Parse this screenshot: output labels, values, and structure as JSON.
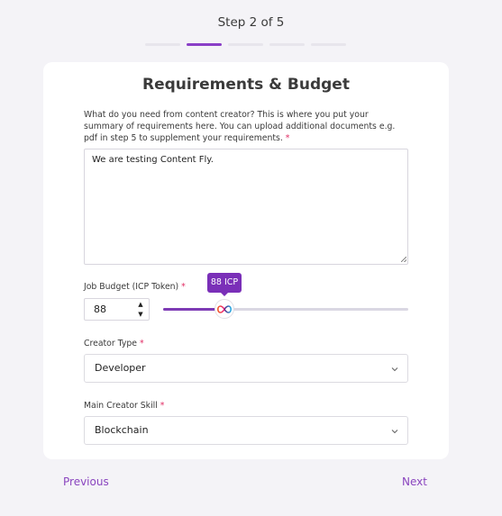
{
  "header": {
    "step_text": "Step 2 of 5",
    "steps": [
      {
        "active": false
      },
      {
        "active": true
      },
      {
        "active": false
      },
      {
        "active": false
      },
      {
        "active": false
      }
    ]
  },
  "card": {
    "title": "Requirements & Budget",
    "requirements": {
      "label": "What do you need from content creator? This is where you put your summary of requirements here. You can upload additional documents e.g. pdf in step 5 to supplement your requirements.",
      "required_mark": "*",
      "value": "We are testing Content Fly."
    },
    "budget": {
      "label": "Job Budget (ICP Token)",
      "required_mark": "*",
      "value": "88",
      "spin_up": "▲",
      "spin_down": "▼",
      "slider_fraction": 0.25,
      "tooltip": "88 ICP"
    },
    "creator_type": {
      "label": "Creator Type",
      "required_mark": "*",
      "selected": "Developer"
    },
    "main_skill": {
      "label": "Main Creator Skill",
      "required_mark": "*",
      "selected": "Blockchain"
    }
  },
  "nav": {
    "previous_label": "Previous",
    "next_label": "Next"
  },
  "colors": {
    "accent": "#7a2fb8",
    "background": "#f4f3f7",
    "required": "#e0245e"
  },
  "icons": {
    "slider_thumb": "infinity-icon",
    "select_arrow": "chevron-down-icon"
  }
}
